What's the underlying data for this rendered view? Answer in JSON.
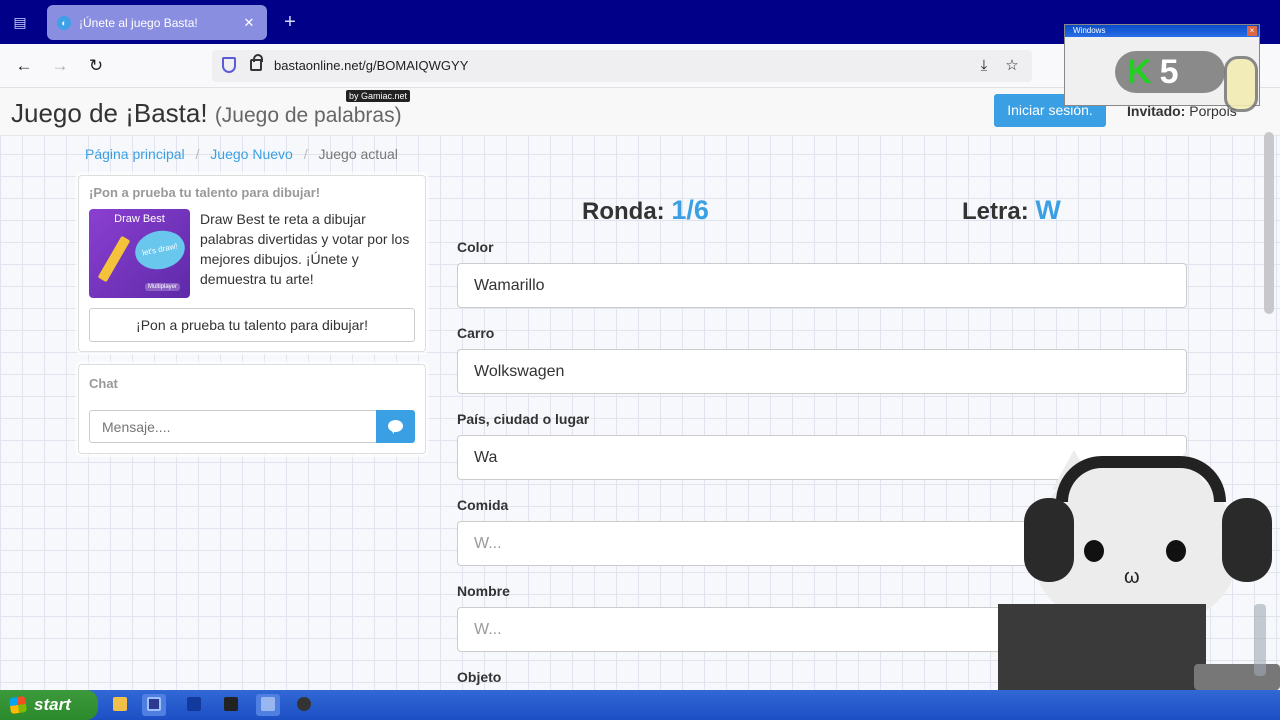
{
  "browser": {
    "tab_title": "¡Únete al juego Basta!",
    "tab_close": "✕",
    "new_tab": "+",
    "url": "bastaonline.net/g/BOMAIQWGYY"
  },
  "header": {
    "title": "Juego de ¡Basta!",
    "subtitle": "(Juego de palabras)",
    "badge": "by Gamiac.net",
    "login_label": "Iniciar sesión.",
    "guest_label": "Invitado:",
    "guest_name": "Porpois"
  },
  "breadcrumb": {
    "home": "Página principal",
    "new_game": "Juego Nuevo",
    "current": "Juego actual",
    "separator": "/"
  },
  "promo": {
    "heading": "¡Pon a prueba tu talento para dibujar!",
    "image_title": "Draw Best",
    "image_bubble": "let's draw!",
    "image_footer": "Multiplayer",
    "text": "Draw Best te reta a dibujar palabras divertidas y votar por los mejores dibujos. ¡Únete y demuestra tu arte!",
    "button": "¡Pon a prueba tu talento para dibujar!"
  },
  "chat": {
    "heading": "Chat",
    "placeholder": "Mensaje...."
  },
  "game": {
    "round_label": "Ronda:",
    "round_value": "1/6",
    "letter_label": "Letra:",
    "letter_value": "W",
    "fields": [
      {
        "label": "Color",
        "value": "Wamarillo"
      },
      {
        "label": "Carro",
        "value": "Wolkswagen"
      },
      {
        "label": "País, ciudad o lugar",
        "value": "Wa"
      },
      {
        "label": "Comida",
        "value": "W..."
      },
      {
        "label": "Nombre",
        "value": "W..."
      },
      {
        "label": "Objeto",
        "value": ""
      }
    ]
  },
  "overlay": {
    "mini_window_title": "Windows",
    "k5_text": "K5"
  },
  "taskbar": {
    "start_label": "start"
  },
  "colors": {
    "accent": "#3ba0e3",
    "tabbar": "#000088",
    "taskbar": "#1d4fc4",
    "start": "#2b8a2b"
  }
}
